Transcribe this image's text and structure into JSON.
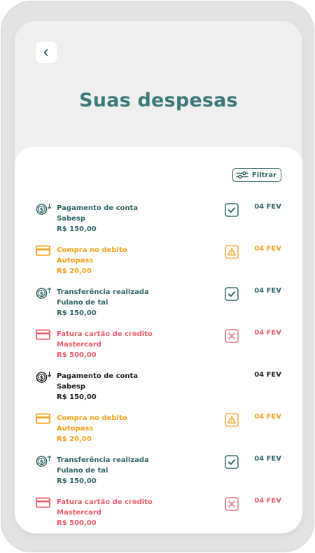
{
  "header": {
    "title": "Suas despesas"
  },
  "filter": {
    "label": "Filtrar"
  },
  "transactions": [
    {
      "title": "Pagamento de conta",
      "subtitle": "Sabesp",
      "amount": "R$ 150,00",
      "date": "04 FEV",
      "icon": "dollar-down-icon",
      "status": "check-icon",
      "color": "#2f6768"
    },
    {
      "title": "Compra no debito",
      "subtitle": "Autopass",
      "amount": "R$ 20,00",
      "date": "04 FEV",
      "icon": "card-icon",
      "status": "warning-icon",
      "color": "#f5a11a"
    },
    {
      "title": "Transferência realizada",
      "subtitle": "Fulano de tal",
      "amount": "R$ 150,00",
      "date": "04 FEV",
      "icon": "dollar-up-icon",
      "status": "check-icon",
      "color": "#2f6768"
    },
    {
      "title": "Fatura cartão de credito",
      "subtitle": "Mastercard",
      "amount": "R$ 500,00",
      "date": "04 FEV",
      "icon": "card-icon",
      "status": "close-icon",
      "color": "#ea5d6b"
    },
    {
      "title": "Pagamento de conta",
      "subtitle": "Sabesp",
      "amount": "R$ 150,00",
      "date": "04 FEV",
      "icon": "dollar-down-icon",
      "status": "none",
      "color": "#222222"
    },
    {
      "title": "Compra no debito",
      "subtitle": "Autopass",
      "amount": "R$ 20,00",
      "date": "04 FEV",
      "icon": "card-icon",
      "status": "warning-icon",
      "color": "#f5a11a"
    },
    {
      "title": "Transferência realizada",
      "subtitle": "Fulano de tal",
      "amount": "R$ 150,00",
      "date": "04 FEV",
      "icon": "dollar-up-icon",
      "status": "check-icon",
      "color": "#2f6768"
    },
    {
      "title": "Fatura cartão de credito",
      "subtitle": "Mastercard",
      "amount": "R$ 500,00",
      "date": "04 FEV",
      "icon": "card-icon",
      "status": "close-icon",
      "color": "#ea5d6b"
    }
  ]
}
